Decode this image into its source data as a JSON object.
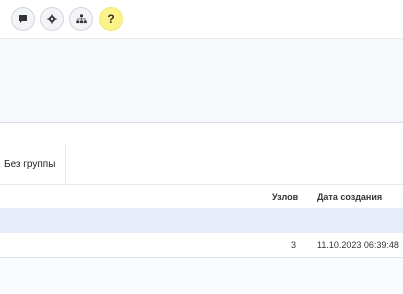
{
  "toolbar": {
    "buttons": [
      {
        "icon": "chat-icon"
      },
      {
        "icon": "gear-icon"
      },
      {
        "icon": "hierarchy-icon"
      },
      {
        "icon": "help-icon",
        "label": "?"
      }
    ],
    "help_color": "#fbf28a"
  },
  "tabs": [
    "Без группы"
  ],
  "table": {
    "columns": [
      "Узлов",
      "Дата создания"
    ],
    "rows": [
      {
        "nodes": "3",
        "created": "11.10.2023 06:39:48"
      }
    ]
  },
  "colors": {
    "selected_row": "#e6ecf8"
  }
}
